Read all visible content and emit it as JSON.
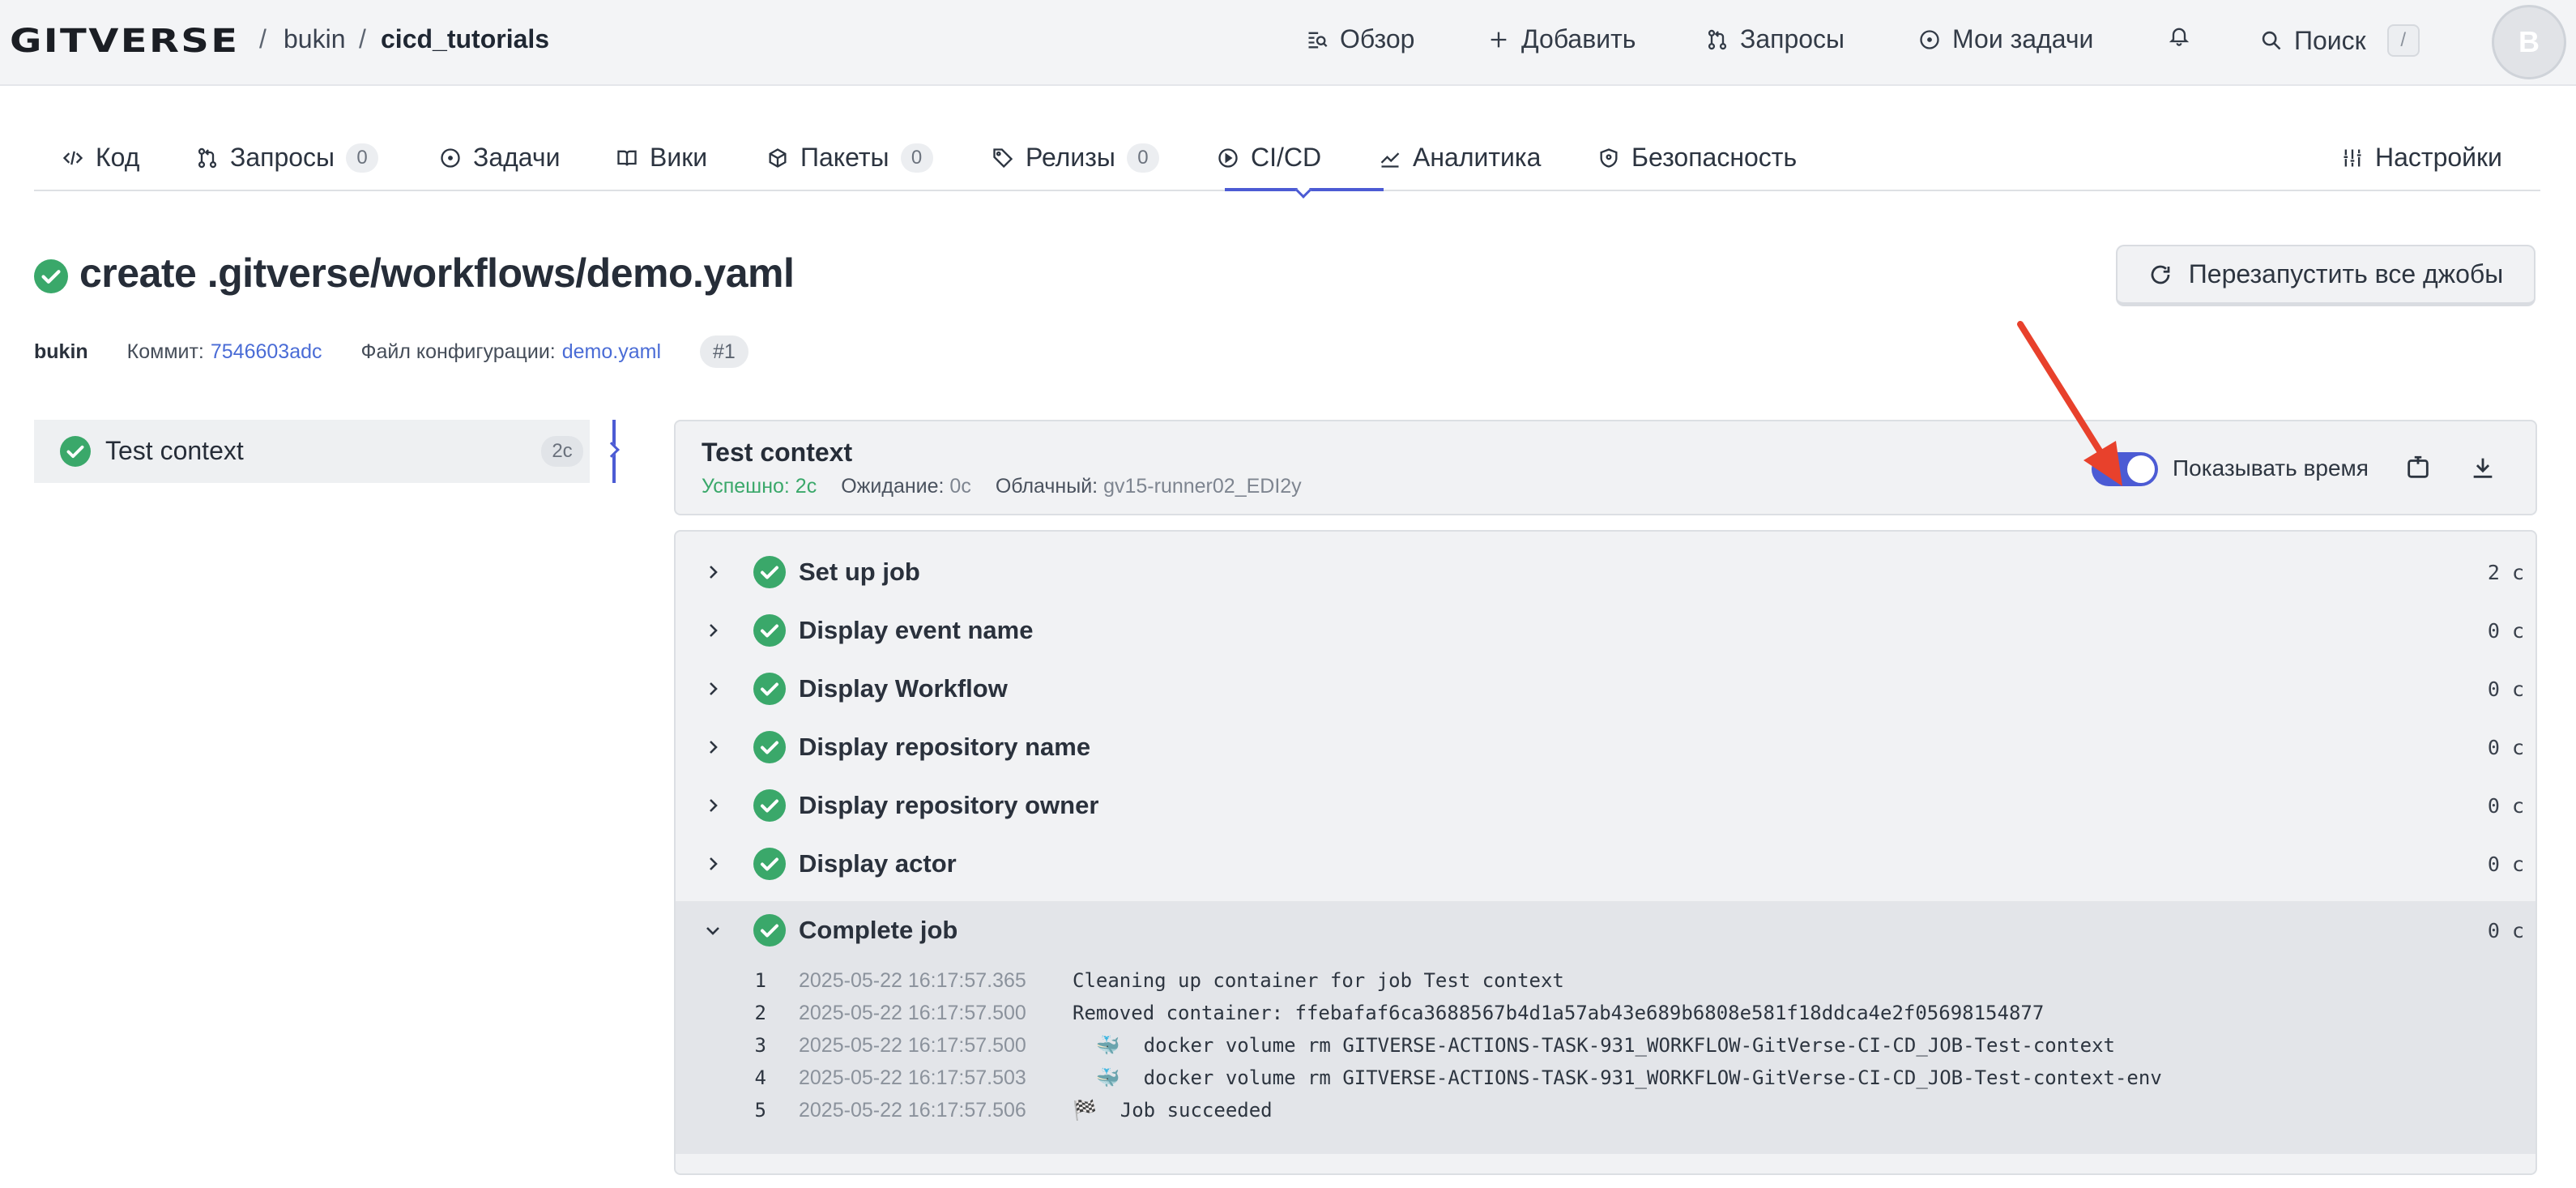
{
  "header": {
    "logo": "GITVERSE",
    "breadcrumb": {
      "owner": "bukin",
      "separator": "/",
      "repo": "cicd_tutorials"
    },
    "nav": {
      "overview": "Обзор",
      "add": "Добавить",
      "requests": "Запросы",
      "my_tasks": "Мои задачи",
      "search": "Поиск",
      "search_shortcut": "/"
    },
    "avatar_initial": "B"
  },
  "tabs": {
    "code": "Код",
    "requests": "Запросы",
    "requests_count": "0",
    "tasks": "Задачи",
    "wiki": "Вики",
    "packages": "Пакеты",
    "packages_count": "0",
    "releases": "Релизы",
    "releases_count": "0",
    "cicd": "CI/CD",
    "analytics": "Аналитика",
    "security": "Безопасность",
    "settings": "Настройки",
    "active": "CI/CD"
  },
  "run": {
    "title": "create .gitverse/workflows/demo.yaml",
    "rerun_label": "Перезапустить все джобы",
    "author": "bukin",
    "commit_label": "Коммит:",
    "commit": "7546603adc",
    "config_label": "Файл конфигурации:",
    "config": "demo.yaml",
    "run_number": "#1"
  },
  "jobs": [
    {
      "name": "Test context",
      "duration": "2с"
    }
  ],
  "job_panel": {
    "title": "Test context",
    "success_label": "Успешно: 2с",
    "waiting_label": "Ожидание:",
    "waiting_value": "0с",
    "runner_label": "Облачный:",
    "runner_value": "gv15-runner02_EDI2y",
    "show_time_label": "Показывать время",
    "show_time_enabled": true
  },
  "steps": [
    {
      "name": "Set up job",
      "duration": "2 с"
    },
    {
      "name": "Display event name",
      "duration": "0 с"
    },
    {
      "name": "Display Workflow",
      "duration": "0 с"
    },
    {
      "name": "Display repository name",
      "duration": "0 с"
    },
    {
      "name": "Display repository owner",
      "duration": "0 с"
    },
    {
      "name": "Display actor",
      "duration": "0 с"
    },
    {
      "name": "Complete job",
      "duration": "0 с"
    }
  ],
  "log": [
    {
      "n": "1",
      "ts": "2025-05-22 16:17:57.365",
      "msg": "Cleaning up container for job Test context"
    },
    {
      "n": "2",
      "ts": "2025-05-22 16:17:57.500",
      "msg": "Removed container: ffebafaf6ca3688567b4d1a57ab43e689b6808e581f18ddca4e2f05698154877"
    },
    {
      "n": "3",
      "ts": "2025-05-22 16:17:57.500",
      "msg": "  🐳  docker volume rm GITVERSE-ACTIONS-TASK-931_WORKFLOW-GitVerse-CI-CD_JOB-Test-context"
    },
    {
      "n": "4",
      "ts": "2025-05-22 16:17:57.503",
      "msg": "  🐳  docker volume rm GITVERSE-ACTIONS-TASK-931_WORKFLOW-GitVerse-CI-CD_JOB-Test-context-env"
    },
    {
      "n": "5",
      "ts": "2025-05-22 16:17:57.506",
      "msg": "🏁  Job succeeded"
    }
  ],
  "colors": {
    "accent": "#4c5bd4",
    "success": "#3aa86a",
    "link": "#4a6cd6",
    "annotation_arrow": "#e8412c"
  }
}
